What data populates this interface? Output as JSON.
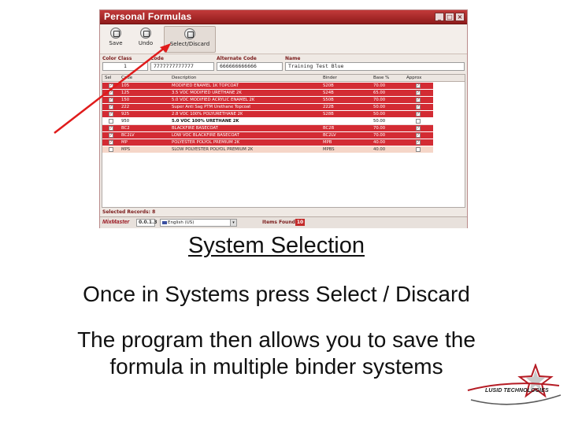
{
  "window": {
    "title": "Personal Formulas",
    "controls": [
      "_",
      "□",
      "×"
    ]
  },
  "toolbar": {
    "buttons": [
      {
        "label": "Save",
        "icon": "save-icon"
      },
      {
        "label": "Undo",
        "icon": "undo-icon"
      },
      {
        "label": "Select/Discard",
        "icon": "select-discard-icon"
      }
    ]
  },
  "fields": {
    "color_class": {
      "label": "Color Class",
      "value": "1"
    },
    "code": {
      "label": "Code",
      "value": "7777777777777"
    },
    "alternate_code": {
      "label": "Alternate Code",
      "value": "666666666666"
    },
    "name": {
      "label": "Name",
      "value": "Training Test Blue"
    }
  },
  "grid": {
    "columns": [
      "Sel",
      "Code",
      "Description",
      "Binder",
      "Base %",
      "Approx"
    ],
    "rows": [
      {
        "selected": true,
        "code": "105",
        "description": "MODIFIED ENAMEL 1K TOPCOAT",
        "binder": "S20B",
        "base": "70.00",
        "approx": true
      },
      {
        "selected": true,
        "code": "125",
        "description": "3.5 VOC MODIFIED URETHANE 2K",
        "binder": "S24B",
        "base": "65.00",
        "approx": true
      },
      {
        "selected": true,
        "code": "150",
        "description": "5.0 VOC MODIFIED ACRYLIC ENAMEL 2K",
        "binder": "S50B",
        "base": "70.00",
        "approx": true
      },
      {
        "selected": true,
        "code": "222",
        "description": "Super Anti Sag PTM Urethane Topcoat",
        "binder": "222B",
        "base": "50.00",
        "approx": true
      },
      {
        "selected": true,
        "code": "925",
        "description": "2.8 VOC 100% POLYURETHANE 2K",
        "binder": "S28B",
        "base": "50.00",
        "approx": true
      },
      {
        "selected": false,
        "code": "950",
        "description": "5.0 VOC 100% URETHANE 2K",
        "binder": "",
        "base": "50.00",
        "approx": false
      },
      {
        "selected": true,
        "code": "BC2",
        "description": "BLACKFIRE BASECOAT",
        "binder": "BC2B",
        "base": "70.00",
        "approx": true
      },
      {
        "selected": true,
        "code": "BC2LV",
        "description": "LOW VOC BLACKFIRE BASECOAT",
        "binder": "BC2LV",
        "base": "70.00",
        "approx": true
      },
      {
        "selected": true,
        "code": "MP",
        "description": "POLYESTER POLYOL PREMIUM 2K",
        "binder": "MPB",
        "base": "40.00",
        "approx": true
      },
      {
        "selected": false,
        "code": "MPS",
        "description": "SLOW POLYESTER POLYOL PREMIUM 2K",
        "binder": "MPBS",
        "base": "40.00",
        "approx": false
      }
    ]
  },
  "footer": {
    "selected_records_label": "Selected Records:",
    "selected_records": "8",
    "app_name": "MixMaster",
    "version": "0.0.1.3",
    "language": "English (US)",
    "items_found_label": "Items Found:",
    "items_found": "10"
  },
  "slide": {
    "heading": "System Selection",
    "line1": "Once in Systems press Select / Discard",
    "line2a": "The program then allows you to save the",
    "line2b": "formula in multiple binder systems"
  },
  "logo": {
    "text": "LUSID TECHNOLOGIES"
  },
  "colors": {
    "selected_row": "#d32b33",
    "title_bar": "#a52a2a",
    "arrow": "#e01b1b"
  }
}
